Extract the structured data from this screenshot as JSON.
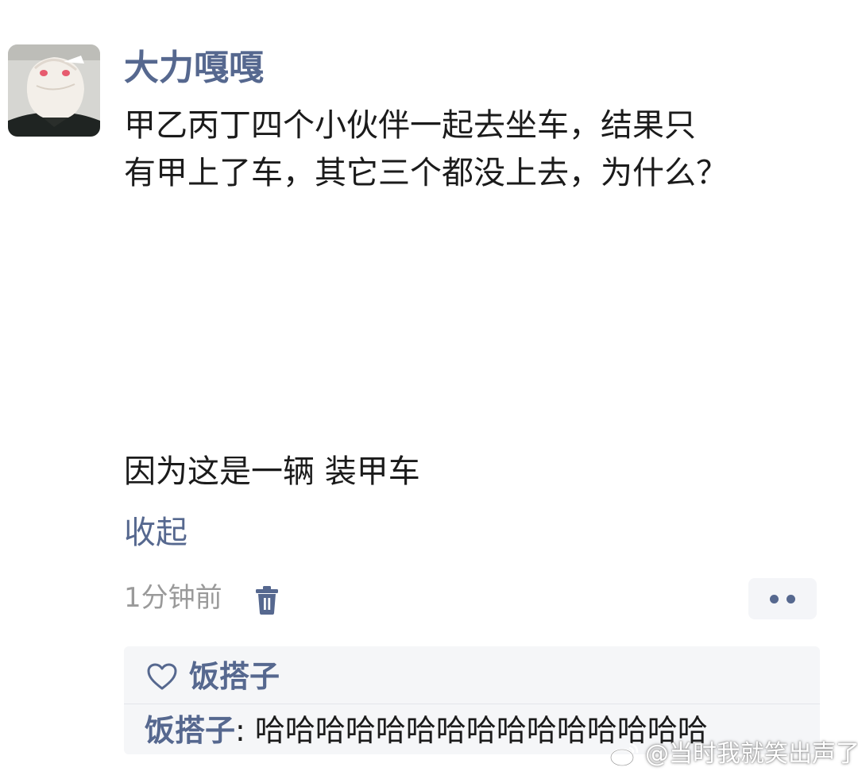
{
  "post": {
    "username": "大力嘎嘎",
    "text_lines": [
      "甲乙丙丁四个小伙伴一起去坐车，结果只",
      "有甲上了车，其它三个都没上去，为什么？"
    ],
    "answer": "因为这是一辆 装甲车",
    "collapse_label": "收起",
    "timestamp": "1分钟前",
    "icons": {
      "delete": "trash-icon",
      "more": "more-dots-icon"
    }
  },
  "interactions": {
    "like_icon": "heart-icon",
    "liker": "饭搭子",
    "reply": {
      "author": "饭搭子",
      "separator": ": ",
      "text": "哈哈哈哈哈哈哈哈哈哈哈哈哈哈哈"
    }
  },
  "watermark": {
    "icon": "weibo-icon",
    "text": "@当时我就笑出声了"
  },
  "colors": {
    "link": "#56688f",
    "text": "#1b1b1b",
    "muted": "#9a9a9a",
    "box_bg": "#f5f6f8"
  }
}
